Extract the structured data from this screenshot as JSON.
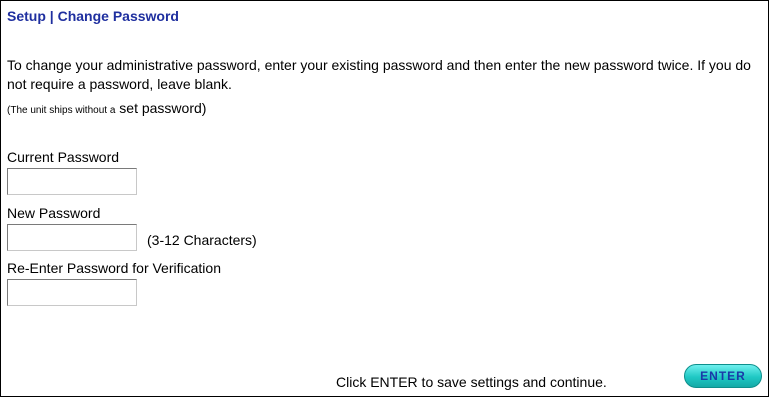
{
  "header": {
    "title": "Setup | Change Password"
  },
  "intro": {
    "text": "To change your administrative password, enter your existing password and then enter the new password twice. If you do not require a password, leave blank.",
    "note_prefix": "(The unit ships without a",
    "note_suffix": "set password)"
  },
  "form": {
    "current_label": "Current Password",
    "current_value": "",
    "new_label": "New Password",
    "new_value": "",
    "new_hint": "(3-12 Characters)",
    "reenter_label": "Re-Enter Password for Verification",
    "reenter_value": ""
  },
  "footer": {
    "instruction": "Click ENTER to save settings and continue.",
    "enter_label": "ENTER"
  },
  "colors": {
    "title": "#1f2f9f",
    "button": "#1fc8c4",
    "button_text": "#1a3aa8"
  }
}
